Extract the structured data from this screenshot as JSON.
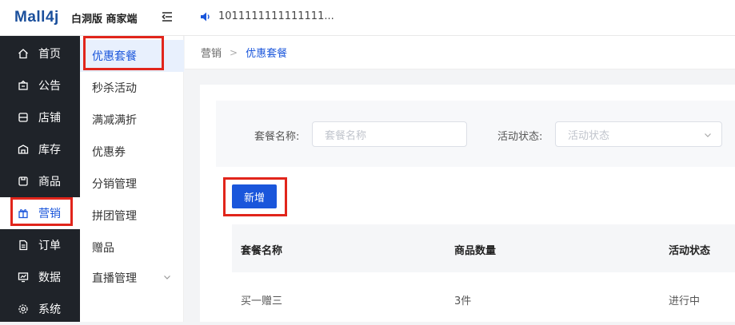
{
  "header": {
    "logo": "Mall4j",
    "subtitle": "白洞版 商家端",
    "notice": "1011111111111111..."
  },
  "sidebar": {
    "items": [
      {
        "label": "首页",
        "icon": "home-icon"
      },
      {
        "label": "公告",
        "icon": "announcement-icon"
      },
      {
        "label": "店铺",
        "icon": "store-icon"
      },
      {
        "label": "库存",
        "icon": "warehouse-icon"
      },
      {
        "label": "商品",
        "icon": "product-icon"
      },
      {
        "label": "营销",
        "icon": "gift-icon",
        "active": true
      },
      {
        "label": "订单",
        "icon": "order-icon"
      },
      {
        "label": "数据",
        "icon": "data-icon"
      },
      {
        "label": "系统",
        "icon": "gear-icon"
      }
    ]
  },
  "submenu": {
    "items": [
      {
        "label": "优惠套餐",
        "active": true
      },
      {
        "label": "秒杀活动"
      },
      {
        "label": "满减满折"
      },
      {
        "label": "优惠券"
      },
      {
        "label": "分销管理"
      },
      {
        "label": "拼团管理"
      },
      {
        "label": "赠品"
      },
      {
        "label": "直播管理",
        "expandable": true
      }
    ]
  },
  "breadcrumb": [
    "营销",
    "优惠套餐"
  ],
  "search": {
    "name_label": "套餐名称:",
    "name_placeholder": "套餐名称",
    "status_label": "活动状态:",
    "status_placeholder": "活动状态"
  },
  "add_button": "新增",
  "table": {
    "columns": [
      "套餐名称",
      "商品数量",
      "活动状态"
    ],
    "rows": [
      [
        "买一赠三",
        "3件",
        "进行中"
      ]
    ]
  },
  "colors": {
    "accent": "#1a56db",
    "sidebar_bg": "#1f2329",
    "highlight_box": "#e1251b"
  }
}
